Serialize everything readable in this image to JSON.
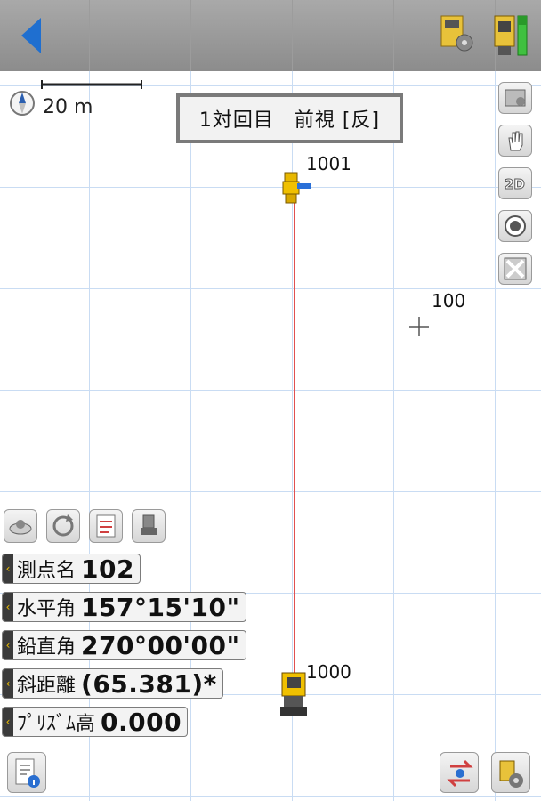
{
  "toolbar": {
    "back_icon": "back-arrow-icon",
    "settings_icon": "settings-icon",
    "device_icon": "total-station-icon"
  },
  "map": {
    "scale_label": "20 m",
    "status": "1対回目　前視 [反]",
    "points": [
      {
        "id": "1001",
        "type": "prism"
      },
      {
        "id": "100",
        "type": "point"
      },
      {
        "id": "1000",
        "type": "station"
      }
    ],
    "line_color": "#e05050",
    "grid_color": "#c9dcf3"
  },
  "right_tools": [
    {
      "name": "layer-icon"
    },
    {
      "name": "hand-pan-icon"
    },
    {
      "name": "2d-view-icon",
      "label": "2D"
    },
    {
      "name": "target-icon"
    },
    {
      "name": "fit-extent-icon"
    }
  ],
  "left_tools": [
    {
      "name": "station-setup-icon"
    },
    {
      "name": "rotate-icon"
    },
    {
      "name": "checklist-icon"
    },
    {
      "name": "instrument-icon"
    }
  ],
  "measurements": [
    {
      "label": "測点名",
      "value": "102"
    },
    {
      "label": "水平角",
      "value": "157°15'10\""
    },
    {
      "label": "鉛直角",
      "value": "270°00'00\""
    },
    {
      "label": "斜距離",
      "value": "(65.381)*"
    },
    {
      "label": "ﾌﾟﾘｽﾞﾑ高",
      "value": "0.000"
    }
  ],
  "bottom_tools": [
    {
      "name": "document-info-icon"
    },
    {
      "name": "transfer-icon"
    },
    {
      "name": "settings-device-icon"
    }
  ],
  "colors": {
    "topbar": "#9a9a9a",
    "back": "#1f6fd0",
    "accent_tab": "#f0c000"
  }
}
